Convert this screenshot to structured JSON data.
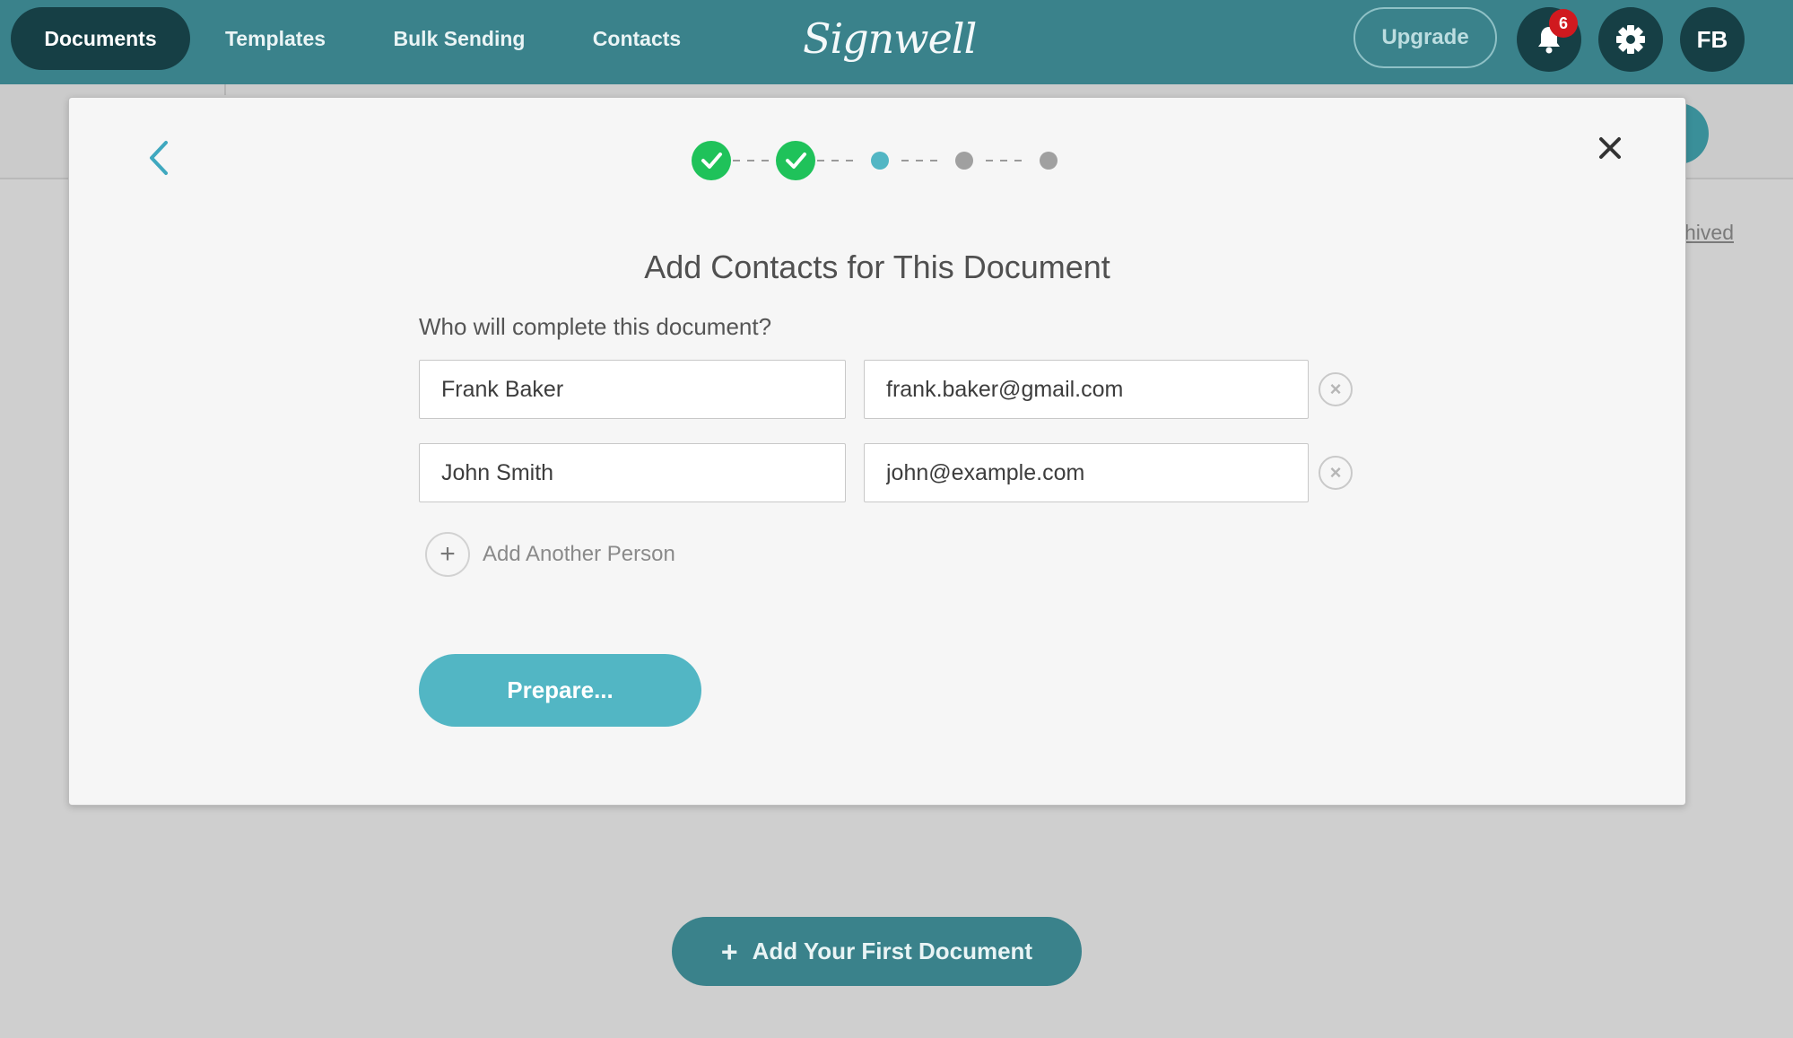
{
  "nav": {
    "items": [
      {
        "label": "Documents",
        "active": true
      },
      {
        "label": "Templates",
        "active": false
      },
      {
        "label": "Bulk Sending",
        "active": false
      },
      {
        "label": "Contacts",
        "active": false
      }
    ],
    "logo": "Signwell",
    "upgrade_label": "Upgrade",
    "notifications_count": "6",
    "avatar_initials": "FB"
  },
  "background": {
    "link_text": "hived",
    "add_first_label": "Add Your First Document"
  },
  "modal": {
    "stepper": {
      "total_steps": 5,
      "current_step": 3,
      "completed_steps": 2
    },
    "title": "Add Contacts for This Document",
    "question": "Who will complete this document?",
    "contacts": [
      {
        "name": "Frank Baker",
        "email": "frank.baker@gmail.com"
      },
      {
        "name": "John Smith",
        "email": "john@example.com"
      }
    ],
    "add_person_label": "Add Another Person",
    "prepare_label": "Prepare..."
  },
  "colors": {
    "topbar": "#3a828b",
    "nav_active": "#163f45",
    "step_complete": "#1fc25a",
    "step_current": "#52b6c4",
    "step_pending": "#a0a0a0",
    "primary_button": "#52b6c4",
    "notification_badge": "#d0191f"
  }
}
